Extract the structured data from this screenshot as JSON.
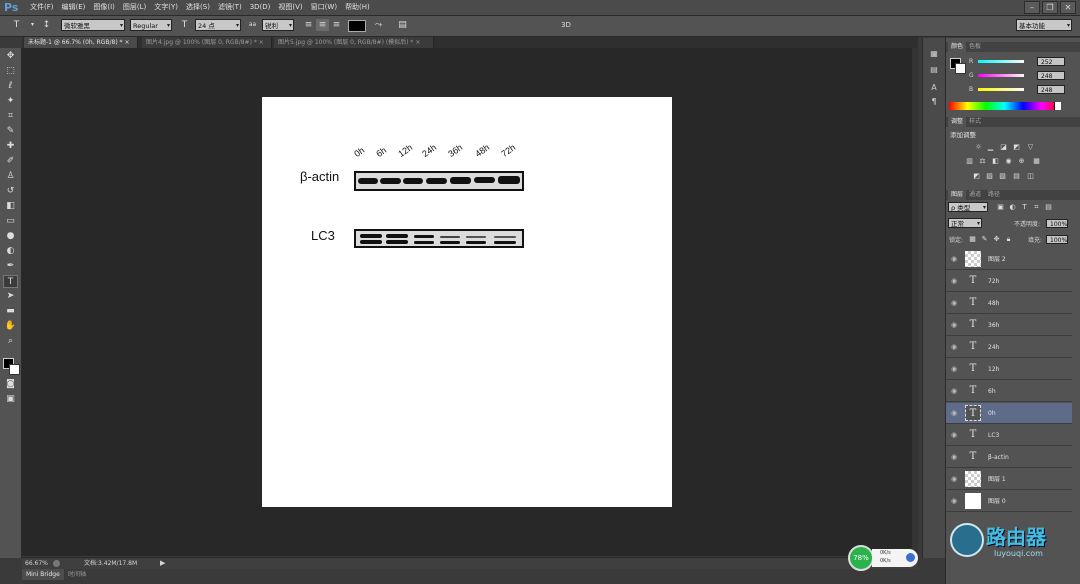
{
  "app": {
    "logo": "Ps"
  },
  "menu": [
    "文件(F)",
    "编辑(E)",
    "图像(I)",
    "图层(L)",
    "文字(Y)",
    "选择(S)",
    "滤镜(T)",
    "3D(D)",
    "视图(V)",
    "窗口(W)",
    "帮助(H)"
  ],
  "window_controls": [
    "–",
    "❐",
    "✕"
  ],
  "options": {
    "tool_icon": "T",
    "font_family": "微软雅黑",
    "font_style": "Regular",
    "font_size": "24 点",
    "size_prefix": "aa",
    "antialias": "锐利",
    "color": "#000000",
    "mode_3d": "3D",
    "workspace": "基本功能"
  },
  "tabs": [
    {
      "label": "未标题-1 @ 66.7% (0h, RGB/8) *",
      "close": "×",
      "active": true
    },
    {
      "label": "图片4.jpg @ 100% (图层 0, RGB/8#) *",
      "close": "×",
      "active": false
    },
    {
      "label": "图片5.jpg @ 100% (图层 0, RGB/8#) (模拟后) *",
      "close": "×",
      "active": false
    }
  ],
  "document": {
    "lanes": [
      "0h",
      "6h",
      "12h",
      "24h",
      "36h",
      "48h",
      "72h"
    ],
    "row1_label": "β-actin",
    "row2_label": "LC3"
  },
  "status": {
    "zoom": "66.67%",
    "doc_size": "文档:3.42M/17.8M",
    "bottom_tabs": [
      "Mini Bridge",
      "时间轴"
    ]
  },
  "color_panel": {
    "tabs": [
      "颜色",
      "色板"
    ],
    "r_label": "R",
    "r": "252",
    "g_label": "G",
    "g": "248",
    "b_label": "B",
    "b": "248"
  },
  "adjust_panel": {
    "tabs": [
      "调整",
      "样式"
    ],
    "title": "添加调整"
  },
  "layers_panel": {
    "tabs": [
      "图层",
      "通道",
      "路径"
    ],
    "filter": "ρ 类型",
    "blend_mode": "正常",
    "opacity_label": "不透明度:",
    "opacity": "100%",
    "lock_label": "锁定:",
    "fill_label": "填充:",
    "fill": "100%",
    "layers": [
      {
        "name": "图层 2",
        "kind": "checker",
        "selected": false
      },
      {
        "name": "72h",
        "kind": "text",
        "selected": false
      },
      {
        "name": "48h",
        "kind": "text",
        "selected": false
      },
      {
        "name": "36h",
        "kind": "text",
        "selected": false
      },
      {
        "name": "24h",
        "kind": "text",
        "selected": false
      },
      {
        "name": "12h",
        "kind": "text",
        "selected": false
      },
      {
        "name": "6h",
        "kind": "text",
        "selected": false
      },
      {
        "name": "0h",
        "kind": "text",
        "selected": true
      },
      {
        "name": "LC3",
        "kind": "text",
        "selected": false
      },
      {
        "name": "β-actin",
        "kind": "text",
        "selected": false
      },
      {
        "name": "图层 1",
        "kind": "checker",
        "selected": false
      },
      {
        "name": "图层 0",
        "kind": "white",
        "selected": false
      }
    ]
  },
  "net_widget": {
    "percent": "78%",
    "up": "0K/s",
    "down": "0K/s"
  },
  "watermark": {
    "title": "路由器",
    "url": "luyouqi.com"
  }
}
